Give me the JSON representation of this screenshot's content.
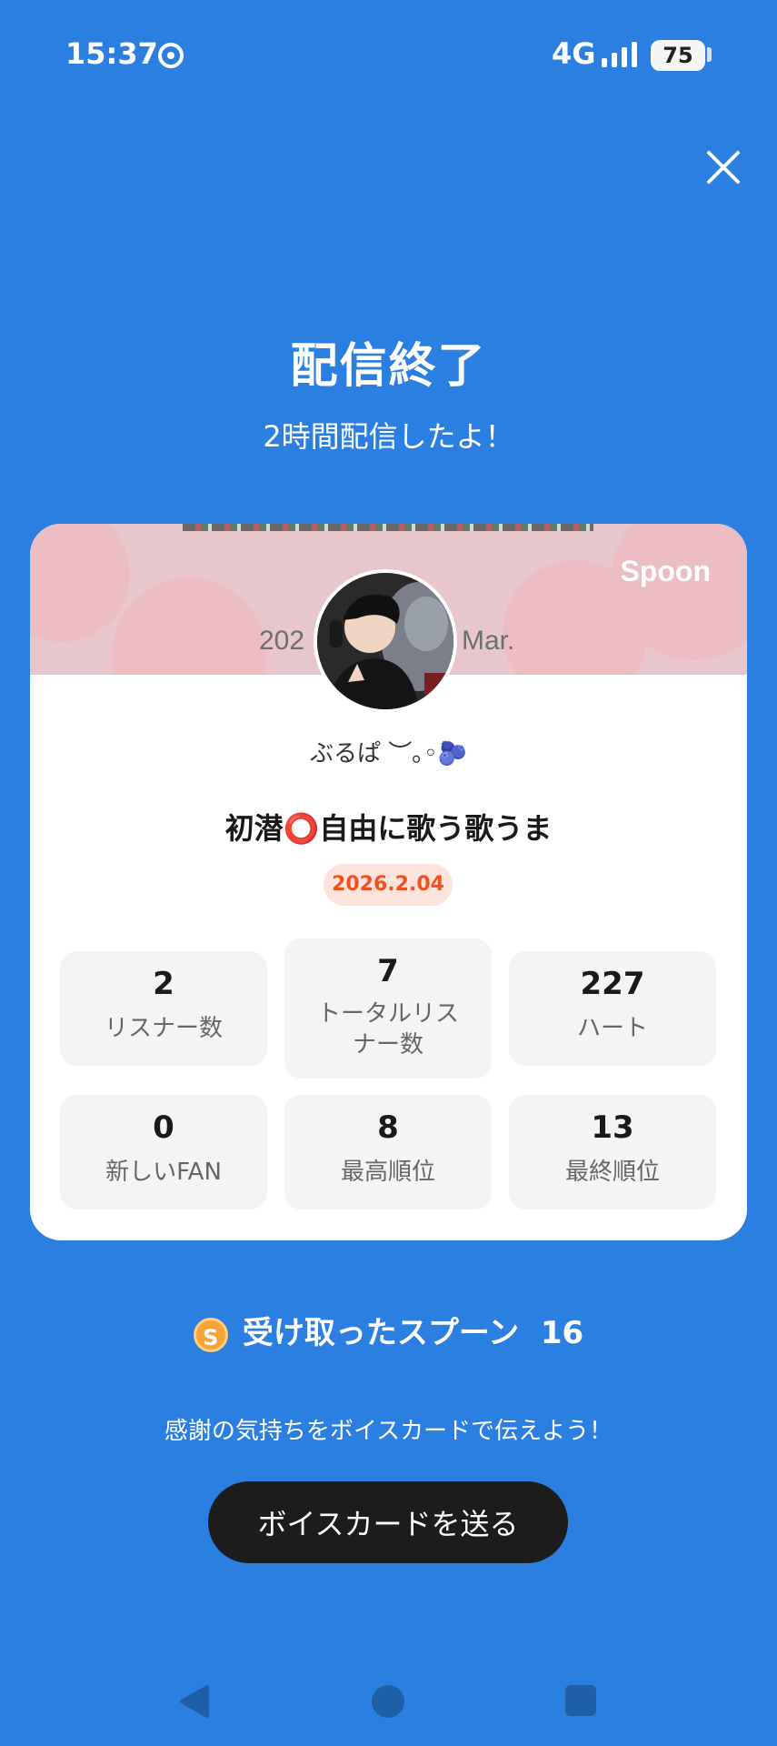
{
  "status_bar": {
    "time": "15:37",
    "network": "4G",
    "battery": "75",
    "icons": [
      "chrome-icon",
      "signal-icon",
      "battery-icon"
    ]
  },
  "header": {
    "close_icon": "close-icon",
    "title": "配信終了",
    "subtitle": "2時間配信したよ！"
  },
  "card": {
    "banner_text_left": "202",
    "banner_text_right": "Mar.",
    "brand": "Spoon",
    "username": "ぶるぱ ︶｡◦🫐",
    "broadcast_title": "初潜⭕自由に歌う歌うま",
    "date": "2026.2.04",
    "stats": [
      {
        "value": "2",
        "label": "リスナー数"
      },
      {
        "value": "7",
        "label": "トータルリスナー数"
      },
      {
        "value": "227",
        "label": "ハート"
      },
      {
        "value": "0",
        "label": "新しいFAN"
      },
      {
        "value": "8",
        "label": "最高順位"
      },
      {
        "value": "13",
        "label": "最終順位"
      }
    ]
  },
  "spoons": {
    "coin_letter": "S",
    "label": "受け取ったスプーン",
    "count": "16"
  },
  "thanks_text": "感謝の気持ちをボイスカードで伝えよう！",
  "voice_card_button": "ボイスカードを送る",
  "colors": {
    "background": "#2a7fe0",
    "card": "#ffffff",
    "accent": "#f0521f",
    "button": "#1c1c1c"
  },
  "nav_bar": [
    "back-icon",
    "home-icon",
    "recents-icon"
  ]
}
